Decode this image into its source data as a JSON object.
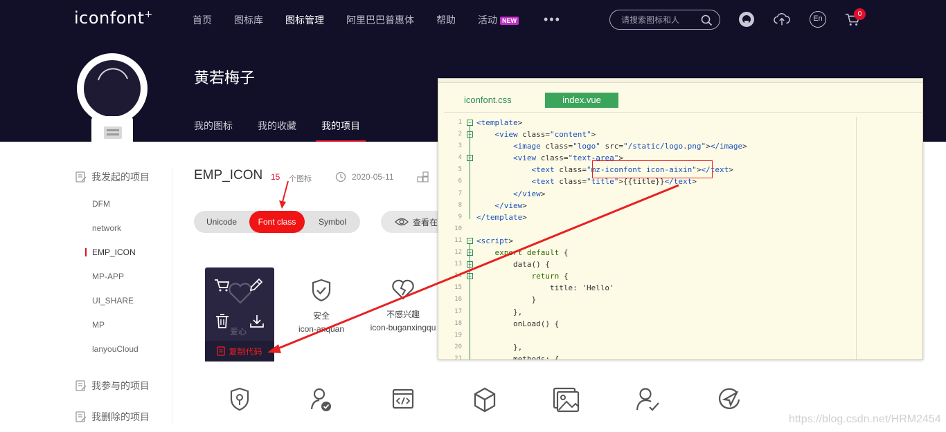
{
  "nav": {
    "logo": "iconfont",
    "logo_plus": "+",
    "items": [
      {
        "label": "首页"
      },
      {
        "label": "图标库"
      },
      {
        "label": "图标管理"
      },
      {
        "label": "阿里巴巴普惠体"
      },
      {
        "label": "帮助"
      },
      {
        "label": "活动"
      }
    ],
    "new_badge": "NEW",
    "more": "•••",
    "search_placeholder": "请搜索图标和人",
    "lang_label": "En",
    "cart_count": "0"
  },
  "profile": {
    "name": "黄若梅子",
    "tabs": [
      {
        "label": "我的图标"
      },
      {
        "label": "我的收藏"
      },
      {
        "label": "我的项目"
      }
    ]
  },
  "sidebar": {
    "started_label": "我发起的项目",
    "projects": [
      "DFM",
      "network",
      "EMP_ICON",
      "MP-APP",
      "UI_SHARE",
      "MP",
      "lanyouCloud"
    ],
    "joined_label": "我参与的项目",
    "deleted_label": "我删除的项目"
  },
  "project": {
    "title": "EMP_ICON",
    "icon_count": "15",
    "icon_unit": "个图标",
    "date": "2020-05-11",
    "modes": [
      "Unicode",
      "Font class",
      "Symbol"
    ],
    "view_button": "查看在"
  },
  "icons": [
    {
      "name": "爱心",
      "code": ""
    },
    {
      "name": "安全",
      "code": "icon-anquan"
    },
    {
      "name": "不感兴趣",
      "code": "icon-buganxingqu"
    }
  ],
  "card": {
    "copy_label": "复制代码"
  },
  "editor": {
    "tabs": [
      "iconfont.css",
      "index.vue"
    ],
    "lines": [
      {
        "n": "1",
        "text": "<template>"
      },
      {
        "n": "2",
        "text": "    <view class=\"content\">"
      },
      {
        "n": "3",
        "text": "        <image class=\"logo\" src=\"/static/logo.png\"></image>"
      },
      {
        "n": "4",
        "text": "        <view class=\"text-area\">"
      },
      {
        "n": "5",
        "text": "            <text class=\"mz-iconfont icon-aixin\"></text>"
      },
      {
        "n": "6",
        "text": "            <text class=\"title\">{{title}}</text>"
      },
      {
        "n": "7",
        "text": "        </view>"
      },
      {
        "n": "8",
        "text": "    </view>"
      },
      {
        "n": "9",
        "text": "</template>"
      },
      {
        "n": "10",
        "text": ""
      },
      {
        "n": "11",
        "text": "<script>"
      },
      {
        "n": "12",
        "text": "    export default {"
      },
      {
        "n": "13",
        "text": "        data() {"
      },
      {
        "n": "14",
        "text": "            return {"
      },
      {
        "n": "15",
        "text": "                title: 'Hello'"
      },
      {
        "n": "16",
        "text": "            }"
      },
      {
        "n": "17",
        "text": "        },"
      },
      {
        "n": "18",
        "text": "        onLoad() {"
      },
      {
        "n": "19",
        "text": ""
      },
      {
        "n": "20",
        "text": "        },"
      },
      {
        "n": "21",
        "text": "        methods: {"
      }
    ]
  },
  "watermark": "https://blog.csdn.net/HRM2454",
  "colors": {
    "brand_red": "#e0102b",
    "nav_bg": "#120f29",
    "editor_bg": "#fdfbe6",
    "active_tab_green": "#3ca55c"
  }
}
